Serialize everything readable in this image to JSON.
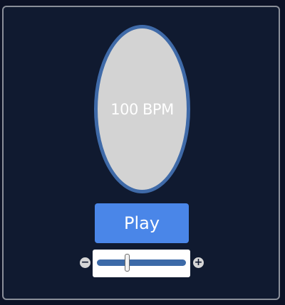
{
  "metronome": {
    "tempo_display": "100 BPM",
    "play_label": "Play",
    "decrease_label": "−",
    "increase_label": "+",
    "tempo_slider": {
      "fraction": 0.33
    }
  },
  "colors": {
    "background": "#101a30",
    "dial_fill": "#d3d3d3",
    "dial_ring": "#3f6aa8",
    "play_button": "#4a86e8",
    "slider_track": "#3c6aa8"
  },
  "icons": {
    "decrease": "minus-icon",
    "increase": "plus-icon"
  }
}
